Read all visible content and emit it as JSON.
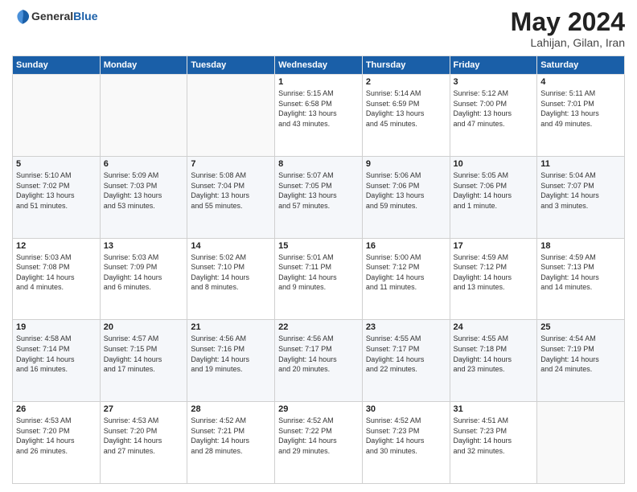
{
  "header": {
    "logo_general": "General",
    "logo_blue": "Blue",
    "title": "May 2024",
    "location": "Lahijan, Gilan, Iran"
  },
  "weekdays": [
    "Sunday",
    "Monday",
    "Tuesday",
    "Wednesday",
    "Thursday",
    "Friday",
    "Saturday"
  ],
  "weeks": [
    [
      {
        "day": "",
        "info": ""
      },
      {
        "day": "",
        "info": ""
      },
      {
        "day": "",
        "info": ""
      },
      {
        "day": "1",
        "info": "Sunrise: 5:15 AM\nSunset: 6:58 PM\nDaylight: 13 hours\nand 43 minutes."
      },
      {
        "day": "2",
        "info": "Sunrise: 5:14 AM\nSunset: 6:59 PM\nDaylight: 13 hours\nand 45 minutes."
      },
      {
        "day": "3",
        "info": "Sunrise: 5:12 AM\nSunset: 7:00 PM\nDaylight: 13 hours\nand 47 minutes."
      },
      {
        "day": "4",
        "info": "Sunrise: 5:11 AM\nSunset: 7:01 PM\nDaylight: 13 hours\nand 49 minutes."
      }
    ],
    [
      {
        "day": "5",
        "info": "Sunrise: 5:10 AM\nSunset: 7:02 PM\nDaylight: 13 hours\nand 51 minutes."
      },
      {
        "day": "6",
        "info": "Sunrise: 5:09 AM\nSunset: 7:03 PM\nDaylight: 13 hours\nand 53 minutes."
      },
      {
        "day": "7",
        "info": "Sunrise: 5:08 AM\nSunset: 7:04 PM\nDaylight: 13 hours\nand 55 minutes."
      },
      {
        "day": "8",
        "info": "Sunrise: 5:07 AM\nSunset: 7:05 PM\nDaylight: 13 hours\nand 57 minutes."
      },
      {
        "day": "9",
        "info": "Sunrise: 5:06 AM\nSunset: 7:06 PM\nDaylight: 13 hours\nand 59 minutes."
      },
      {
        "day": "10",
        "info": "Sunrise: 5:05 AM\nSunset: 7:06 PM\nDaylight: 14 hours\nand 1 minute."
      },
      {
        "day": "11",
        "info": "Sunrise: 5:04 AM\nSunset: 7:07 PM\nDaylight: 14 hours\nand 3 minutes."
      }
    ],
    [
      {
        "day": "12",
        "info": "Sunrise: 5:03 AM\nSunset: 7:08 PM\nDaylight: 14 hours\nand 4 minutes."
      },
      {
        "day": "13",
        "info": "Sunrise: 5:03 AM\nSunset: 7:09 PM\nDaylight: 14 hours\nand 6 minutes."
      },
      {
        "day": "14",
        "info": "Sunrise: 5:02 AM\nSunset: 7:10 PM\nDaylight: 14 hours\nand 8 minutes."
      },
      {
        "day": "15",
        "info": "Sunrise: 5:01 AM\nSunset: 7:11 PM\nDaylight: 14 hours\nand 9 minutes."
      },
      {
        "day": "16",
        "info": "Sunrise: 5:00 AM\nSunset: 7:12 PM\nDaylight: 14 hours\nand 11 minutes."
      },
      {
        "day": "17",
        "info": "Sunrise: 4:59 AM\nSunset: 7:12 PM\nDaylight: 14 hours\nand 13 minutes."
      },
      {
        "day": "18",
        "info": "Sunrise: 4:59 AM\nSunset: 7:13 PM\nDaylight: 14 hours\nand 14 minutes."
      }
    ],
    [
      {
        "day": "19",
        "info": "Sunrise: 4:58 AM\nSunset: 7:14 PM\nDaylight: 14 hours\nand 16 minutes."
      },
      {
        "day": "20",
        "info": "Sunrise: 4:57 AM\nSunset: 7:15 PM\nDaylight: 14 hours\nand 17 minutes."
      },
      {
        "day": "21",
        "info": "Sunrise: 4:56 AM\nSunset: 7:16 PM\nDaylight: 14 hours\nand 19 minutes."
      },
      {
        "day": "22",
        "info": "Sunrise: 4:56 AM\nSunset: 7:17 PM\nDaylight: 14 hours\nand 20 minutes."
      },
      {
        "day": "23",
        "info": "Sunrise: 4:55 AM\nSunset: 7:17 PM\nDaylight: 14 hours\nand 22 minutes."
      },
      {
        "day": "24",
        "info": "Sunrise: 4:55 AM\nSunset: 7:18 PM\nDaylight: 14 hours\nand 23 minutes."
      },
      {
        "day": "25",
        "info": "Sunrise: 4:54 AM\nSunset: 7:19 PM\nDaylight: 14 hours\nand 24 minutes."
      }
    ],
    [
      {
        "day": "26",
        "info": "Sunrise: 4:53 AM\nSunset: 7:20 PM\nDaylight: 14 hours\nand 26 minutes."
      },
      {
        "day": "27",
        "info": "Sunrise: 4:53 AM\nSunset: 7:20 PM\nDaylight: 14 hours\nand 27 minutes."
      },
      {
        "day": "28",
        "info": "Sunrise: 4:52 AM\nSunset: 7:21 PM\nDaylight: 14 hours\nand 28 minutes."
      },
      {
        "day": "29",
        "info": "Sunrise: 4:52 AM\nSunset: 7:22 PM\nDaylight: 14 hours\nand 29 minutes."
      },
      {
        "day": "30",
        "info": "Sunrise: 4:52 AM\nSunset: 7:23 PM\nDaylight: 14 hours\nand 30 minutes."
      },
      {
        "day": "31",
        "info": "Sunrise: 4:51 AM\nSunset: 7:23 PM\nDaylight: 14 hours\nand 32 minutes."
      },
      {
        "day": "",
        "info": ""
      }
    ]
  ]
}
